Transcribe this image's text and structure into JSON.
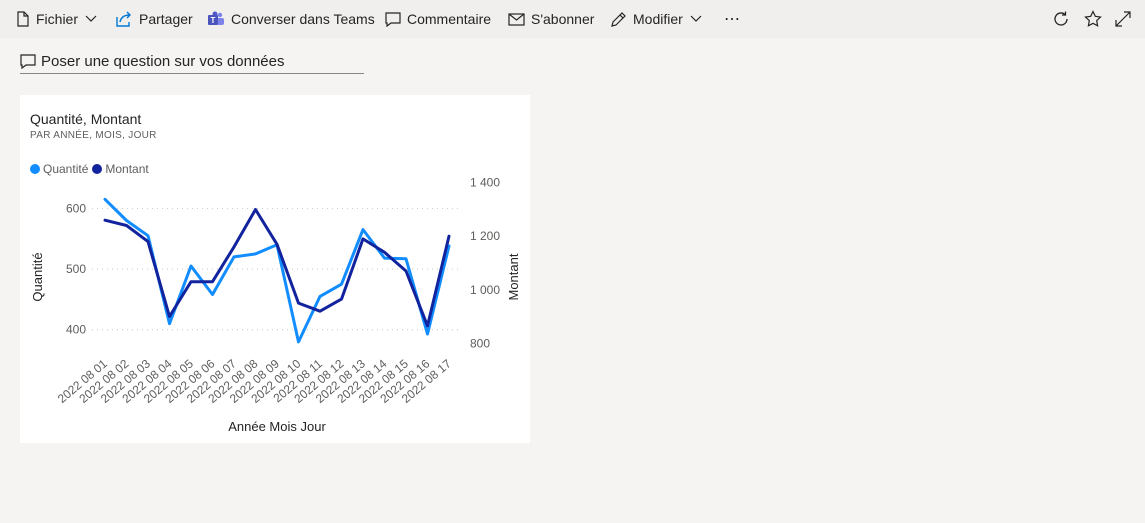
{
  "toolbar": {
    "file": "Fichier",
    "share": "Partager",
    "teams": "Converser dans Teams",
    "comment": "Commentaire",
    "subscribe": "S'abonner",
    "edit": "Modifier",
    "more": "⋯"
  },
  "qa": {
    "label": "Poser une question sur vos données"
  },
  "tile": {
    "title": "Quantité, Montant",
    "subtitle": "PAR ANNÉE, MOIS, JOUR"
  },
  "colors": {
    "quantite": "#118dff",
    "montant": "#12239e",
    "accent": "#0078d4"
  },
  "icons": [
    "file-icon",
    "share-icon",
    "teams-icon",
    "comment-icon",
    "mail-icon",
    "pencil-icon",
    "more-icon",
    "refresh-icon",
    "star-icon",
    "expand-icon",
    "chat-icon"
  ],
  "chart_data": {
    "type": "line",
    "title": "Quantité, Montant",
    "subtitle": "PAR ANNÉE, MOIS, JOUR",
    "xlabel": "Année Mois Jour",
    "categories": [
      "2022 08 01",
      "2022 08 02",
      "2022 08 03",
      "2022 08 04",
      "2022 08 05",
      "2022 08 06",
      "2022 08 07",
      "2022 08 08",
      "2022 08 09",
      "2022 08 10",
      "2022 08 11",
      "2022 08 12",
      "2022 08 13",
      "2022 08 14",
      "2022 08 15",
      "2022 08 16",
      "2022 08 17"
    ],
    "y_left": {
      "label": "Quantité",
      "ticks": [
        400,
        500,
        600
      ],
      "tick_labels": [
        "400",
        "500",
        "600"
      ],
      "range": [
        360,
        660
      ]
    },
    "y_right": {
      "label": "Montant",
      "ticks": [
        800,
        1000,
        1200,
        1400
      ],
      "tick_labels": [
        "800",
        "1 000",
        "1 200",
        "1 400"
      ],
      "range": [
        760,
        1440
      ]
    },
    "grid": true,
    "legend": "top-left",
    "series": [
      {
        "name": "Quantité",
        "axis": "left",
        "values": [
          615,
          580,
          555,
          410,
          505,
          458,
          520,
          525,
          540,
          380,
          455,
          475,
          565,
          518,
          517,
          393,
          538
        ]
      },
      {
        "name": "Montant",
        "axis": "right",
        "values": [
          1260,
          1240,
          1180,
          900,
          1030,
          1030,
          1160,
          1300,
          1170,
          950,
          920,
          965,
          1190,
          1140,
          1070,
          865,
          1200
        ]
      }
    ]
  }
}
